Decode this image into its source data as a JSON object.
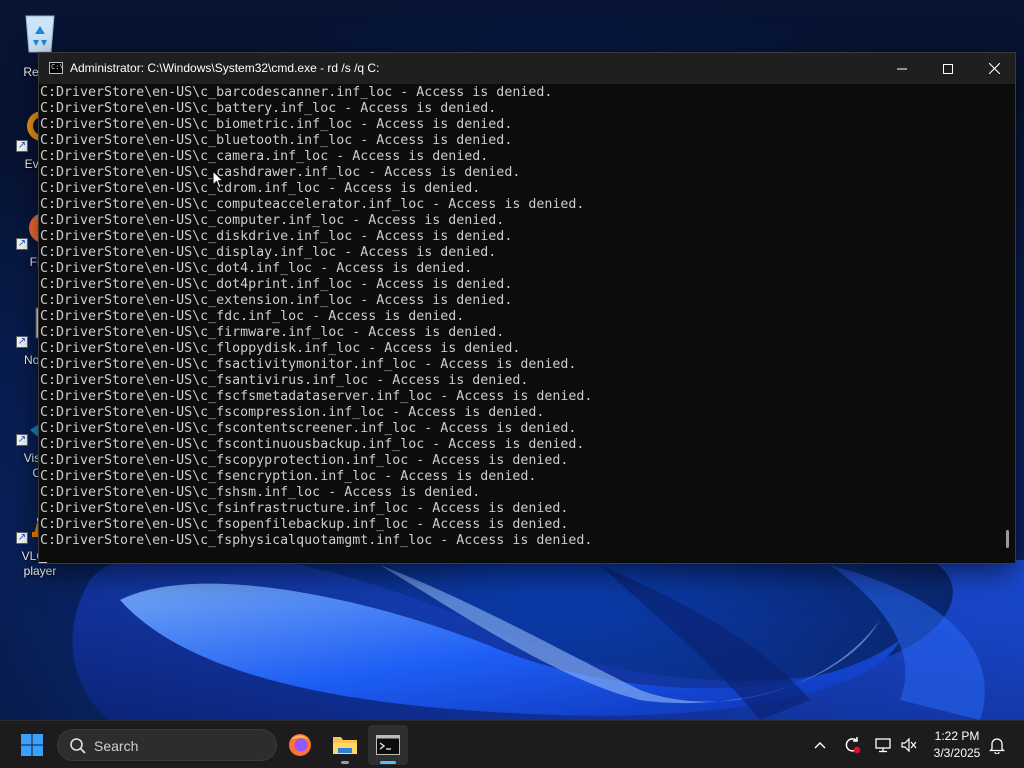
{
  "desktop": {
    "icons": [
      {
        "label": "Recyc",
        "icon": "recycle-bin-icon"
      },
      {
        "label": "Every",
        "icon": "everything-icon"
      },
      {
        "label": "Fire",
        "icon": "firefox-icon"
      },
      {
        "label": "Notep",
        "icon": "notepad-icon"
      },
      {
        "label": "Visual",
        "label2": "Co",
        "icon": "vscode-icon"
      },
      {
        "label": "VLC m",
        "label2": "player",
        "icon": "vlc-icon"
      }
    ]
  },
  "cmd_window": {
    "title": "Administrator: C:\\Windows\\System32\\cmd.exe - rd  /s /q C:",
    "icon": "cmd-icon",
    "lines": [
      "C:DriverStore\\en-US\\c_barcodescanner.inf_loc - Access is denied.",
      "C:DriverStore\\en-US\\c_battery.inf_loc - Access is denied.",
      "C:DriverStore\\en-US\\c_biometric.inf_loc - Access is denied.",
      "C:DriverStore\\en-US\\c_bluetooth.inf_loc - Access is denied.",
      "C:DriverStore\\en-US\\c_camera.inf_loc - Access is denied.",
      "C:DriverStore\\en-US\\c_cashdrawer.inf_loc - Access is denied.",
      "C:DriverStore\\en-US\\c_cdrom.inf_loc - Access is denied.",
      "C:DriverStore\\en-US\\c_computeaccelerator.inf_loc - Access is denied.",
      "C:DriverStore\\en-US\\c_computer.inf_loc - Access is denied.",
      "C:DriverStore\\en-US\\c_diskdrive.inf_loc - Access is denied.",
      "C:DriverStore\\en-US\\c_display.inf_loc - Access is denied.",
      "C:DriverStore\\en-US\\c_dot4.inf_loc - Access is denied.",
      "C:DriverStore\\en-US\\c_dot4print.inf_loc - Access is denied.",
      "C:DriverStore\\en-US\\c_extension.inf_loc - Access is denied.",
      "C:DriverStore\\en-US\\c_fdc.inf_loc - Access is denied.",
      "C:DriverStore\\en-US\\c_firmware.inf_loc - Access is denied.",
      "C:DriverStore\\en-US\\c_floppydisk.inf_loc - Access is denied.",
      "C:DriverStore\\en-US\\c_fsactivitymonitor.inf_loc - Access is denied.",
      "C:DriverStore\\en-US\\c_fsantivirus.inf_loc - Access is denied.",
      "C:DriverStore\\en-US\\c_fscfsmetadataserver.inf_loc - Access is denied.",
      "C:DriverStore\\en-US\\c_fscompression.inf_loc - Access is denied.",
      "C:DriverStore\\en-US\\c_fscontentscreener.inf_loc - Access is denied.",
      "C:DriverStore\\en-US\\c_fscontinuousbackup.inf_loc - Access is denied.",
      "C:DriverStore\\en-US\\c_fscopyprotection.inf_loc - Access is denied.",
      "C:DriverStore\\en-US\\c_fsencryption.inf_loc - Access is denied.",
      "C:DriverStore\\en-US\\c_fshsm.inf_loc - Access is denied.",
      "C:DriverStore\\en-US\\c_fsinfrastructure.inf_loc - Access is denied.",
      "C:DriverStore\\en-US\\c_fsopenfilebackup.inf_loc - Access is denied.",
      "C:DriverStore\\en-US\\c_fsphysicalquotamgmt.inf_loc - Access is denied."
    ]
  },
  "taskbar": {
    "search_label": "Search",
    "time": "1:22 PM",
    "date": "3/3/2025",
    "pinned": [
      "firefox-icon",
      "file-explorer-icon",
      "terminal-icon"
    ],
    "tray": [
      "chevron-up-icon",
      "update-icon",
      "network-icon",
      "volume-muted-icon",
      "bell-icon"
    ]
  },
  "colors": {
    "console_bg": "#0c0c0c",
    "console_text": "#cccccc",
    "titlebar_bg": "#1f1f1f",
    "taskbar_bg": "#1c1c1c",
    "accent": "#4cc2ff"
  }
}
